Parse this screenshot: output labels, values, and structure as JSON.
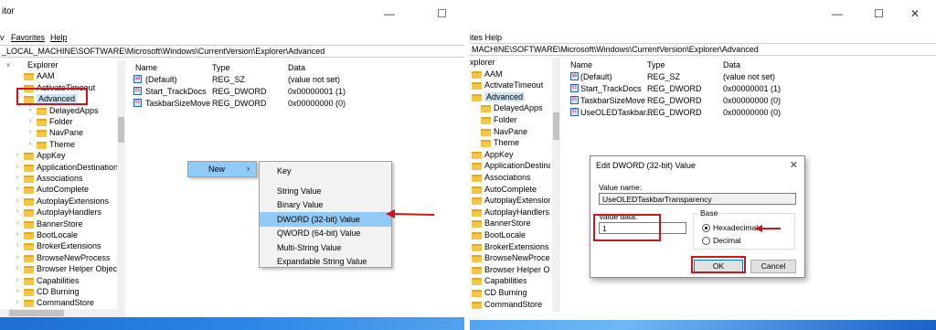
{
  "left": {
    "title": "Registry Editor",
    "title_visible": "itor",
    "menu": [
      "Favorites",
      "Help"
    ],
    "menu_partial": "v",
    "address": "_LOCAL_MACHINE\\SOFTWARE\\Microsoft\\Windows\\CurrentVersion\\Explorer\\Advanced",
    "tree": [
      {
        "label": "Explorer"
      },
      {
        "label": "AAM"
      },
      {
        "label": "ActivateTimeout"
      },
      {
        "label": "Advanced"
      },
      {
        "label": "DelayedApps"
      },
      {
        "label": "Folder"
      },
      {
        "label": "NavPane"
      },
      {
        "label": "Theme"
      },
      {
        "label": "AppKey"
      },
      {
        "label": "ApplicationDestinations"
      },
      {
        "label": "Associations"
      },
      {
        "label": "AutoComplete"
      },
      {
        "label": "AutoplayExtensions"
      },
      {
        "label": "AutoplayHandlers"
      },
      {
        "label": "BannerStore"
      },
      {
        "label": "BootLocale"
      },
      {
        "label": "BrokerExtensions"
      },
      {
        "label": "BrowseNewProcess"
      },
      {
        "label": "Browser Helper Objects"
      },
      {
        "label": "Capabilities"
      },
      {
        "label": "CD Burning"
      },
      {
        "label": "CommandStore"
      }
    ],
    "columns": [
      "Name",
      "Type",
      "Data"
    ],
    "values": [
      {
        "name": "(Default)",
        "type": "REG_SZ",
        "data": "(value not set)",
        "icon": "string-value-icon"
      },
      {
        "name": "Start_TrackDocs",
        "type": "REG_DWORD",
        "data": "0x00000001 (1)",
        "icon": "dword-value-icon"
      },
      {
        "name": "TaskbarSizeMove",
        "type": "REG_DWORD",
        "data": "0x00000000 (0)",
        "icon": "dword-value-icon"
      }
    ],
    "context_new": "New",
    "submenu": [
      "Key",
      "String Value",
      "Binary Value",
      "DWORD (32-bit) Value",
      "QWORD (64-bit) Value",
      "Multi-String Value",
      "Expandable String Value"
    ],
    "highlight_color": "#91c9f7",
    "annotation_color": "#d0141a"
  },
  "right": {
    "address": "MACHINE\\SOFTWARE\\Microsoft\\Windows\\CurrentVersion\\Explorer\\Advanced",
    "menu_partial": "ites  Help",
    "tree": [
      {
        "label": "xplorer"
      },
      {
        "label": "AAM"
      },
      {
        "label": "ActivateTimeout"
      },
      {
        "label": "Advanced"
      },
      {
        "label": "DelayedApps"
      },
      {
        "label": "Folder"
      },
      {
        "label": "NavPane"
      },
      {
        "label": "Theme"
      },
      {
        "label": "AppKey"
      },
      {
        "label": "ApplicationDestinations"
      },
      {
        "label": "Associations"
      },
      {
        "label": "AutoComplete"
      },
      {
        "label": "AutoplayExtensions"
      },
      {
        "label": "AutoplayHandlers"
      },
      {
        "label": "BannerStore"
      },
      {
        "label": "BootLocale"
      },
      {
        "label": "BrokerExtensions"
      },
      {
        "label": "BrowseNewProcess"
      },
      {
        "label": "Browser Helper Objects"
      },
      {
        "label": "Capabilities"
      },
      {
        "label": "CD Burning"
      },
      {
        "label": "CommandStore"
      }
    ],
    "columns": [
      "Name",
      "Type",
      "Data"
    ],
    "values": [
      {
        "name": "(Default)",
        "type": "REG_SZ",
        "data": "(value not set)",
        "icon": "string-value-icon"
      },
      {
        "name": "Start_TrackDocs",
        "type": "REG_DWORD",
        "data": "0x00000001 (1)",
        "icon": "dword-value-icon"
      },
      {
        "name": "TaskbarSizeMove",
        "type": "REG_DWORD",
        "data": "0x00000000 (0)",
        "icon": "dword-value-icon"
      },
      {
        "name": "UseOLEDTaskbar...",
        "type": "REG_DWORD",
        "data": "0x00000000 (0)",
        "icon": "dword-value-icon"
      }
    ],
    "dialog": {
      "title": "Edit DWORD (32-bit) Value",
      "value_name_label": "Value name:",
      "value_name": "UseOLEDTaskbarTransparency",
      "value_data_label": "Value data:",
      "value_data": "1",
      "base_label": "Base",
      "hex_label": "Hexadecimal",
      "dec_label": "Decimal",
      "ok": "OK",
      "cancel": "Cancel"
    }
  }
}
